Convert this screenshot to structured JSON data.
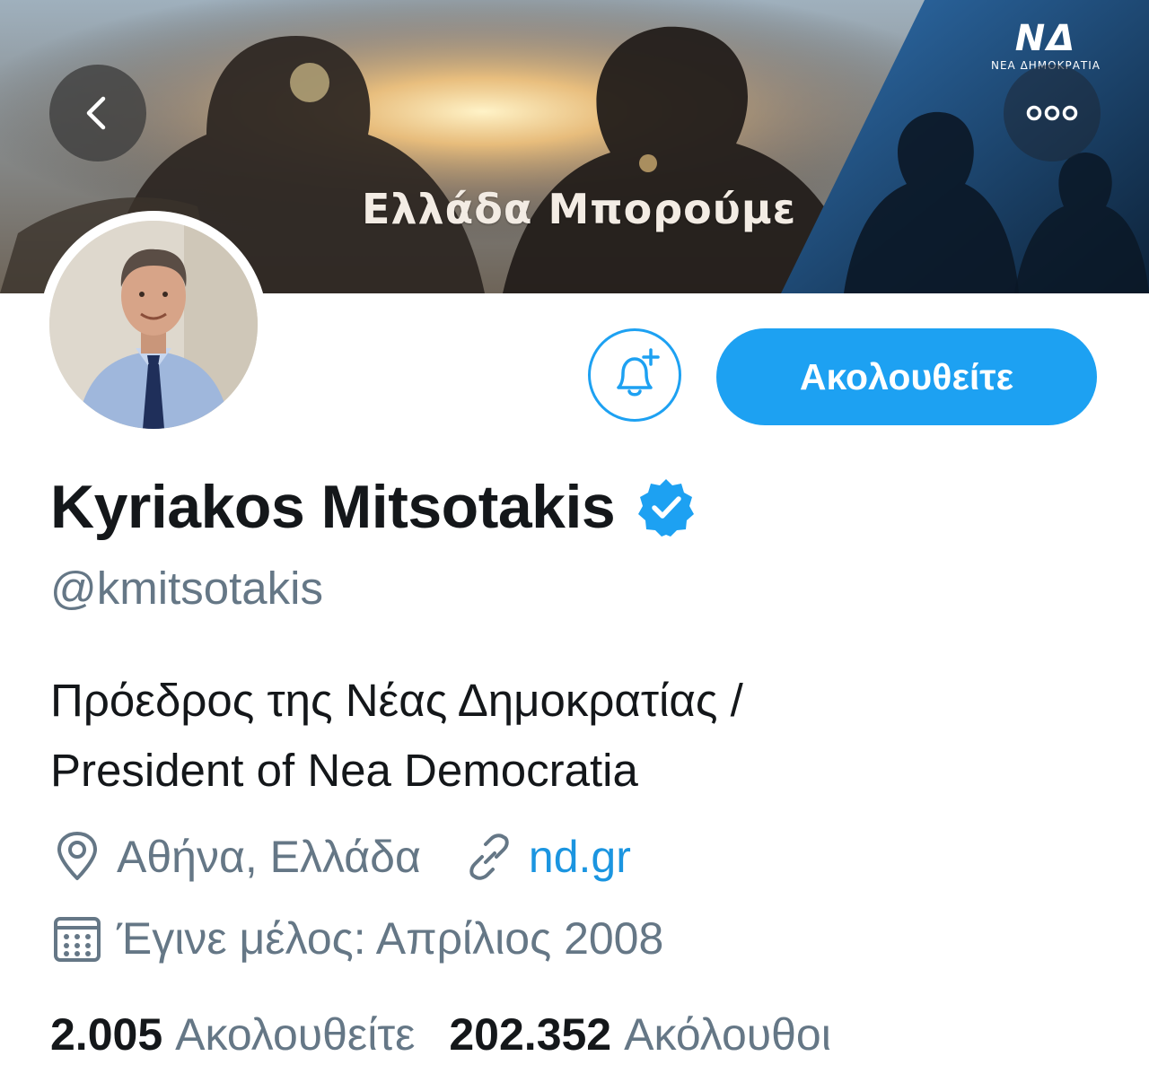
{
  "banner": {
    "tagline": "Ελλάδα Μπορούμε",
    "party_logo_mark": "ΝΔ",
    "party_logo_text": "ΝΕΑ ΔΗΜΟΚΡΑΤΙΑ"
  },
  "nav": {
    "back_icon": "chevron-left-icon",
    "more_icon": "more-dots-icon"
  },
  "actions": {
    "notify_icon": "bell-plus-icon",
    "follow_label": "Ακολουθείτε"
  },
  "profile": {
    "display_name": "Kyriakos Mitsotakis",
    "verified": true,
    "handle": "@kmitsotakis",
    "bio_line1": "Πρόεδρος της Νέας Δημοκρατίας /",
    "bio_line2": "President of Nea Democratia",
    "location": "Αθήνα, Ελλάδα",
    "website": "nd.gr",
    "joined": "Έγινε μέλος: Απρίλιος 2008"
  },
  "stats": {
    "following_count": "2.005",
    "following_label": "Ακολουθείτε",
    "followers_count": "202.352",
    "followers_label": "Ακόλουθοι"
  },
  "colors": {
    "accent": "#1da1f2",
    "link": "#1b95e0",
    "secondary_text": "#657786",
    "primary_text": "#14171a"
  }
}
